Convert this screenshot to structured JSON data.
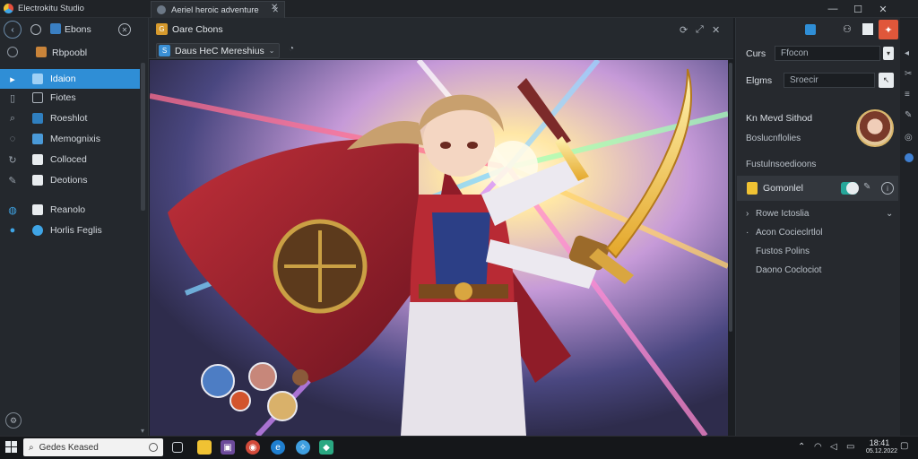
{
  "window": {
    "app_title": "Electrokitu Studio",
    "minimize": "—",
    "maximize": "☐",
    "close": "✕"
  },
  "tab": {
    "title": "Aeriel heroic adventure",
    "close": "✕",
    "new": "✕"
  },
  "sidebar": {
    "back_label": "",
    "header_title": "Ebons",
    "header_sub": "Rbpoobl",
    "items": [
      {
        "label": "Idaion",
        "icon": "play-icon",
        "selected": true
      },
      {
        "label": "Fiotes",
        "icon": "file-icon"
      },
      {
        "label": "Roeshlot",
        "icon": "search-icon"
      },
      {
        "label": "Memognixis",
        "icon": "chat-icon"
      },
      {
        "label": "Colloced",
        "icon": "sync-icon"
      },
      {
        "label": "Deotions",
        "icon": "pen-icon"
      }
    ],
    "secondary": [
      {
        "label": "Reanolo",
        "icon": "globe-icon"
      },
      {
        "label": "Horlis Feglis",
        "icon": "circle-icon"
      }
    ]
  },
  "panel": {
    "title": "Oare Cbons",
    "breadcrumb": "Daus HeC Mereshius",
    "controls": [
      "⟳",
      "⤢",
      "✕"
    ]
  },
  "right": {
    "field1_label": "Curs",
    "field1_value": "Ffocon",
    "field2_label": "Elgms",
    "field2_value": "Sroecir",
    "profile_name": "Kn Mevd Sithod",
    "profile_sub": "Boslucnflolies",
    "section_title": "Fustulnsoedioons",
    "selected_item": "Gomonlel",
    "subitems": [
      "Rowe Ictoslia",
      "Acon Cocieclrtlol",
      "Fustos Polins",
      "Daono Coclociot"
    ]
  },
  "taskbar": {
    "search_placeholder": "Gedes Keased",
    "time": "18:41",
    "date": "05.12.2022"
  },
  "colors": {
    "accent": "#2f8ed6",
    "close": "#c42b1c",
    "bg": "#1b1e22"
  }
}
